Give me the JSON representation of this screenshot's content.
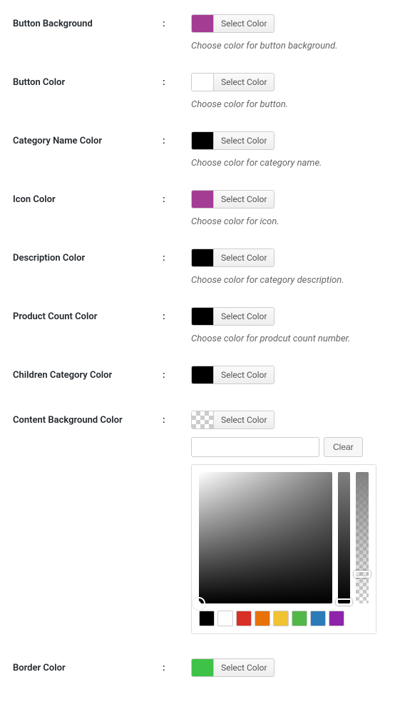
{
  "selectColorLabel": "Select Color",
  "clearLabel": "Clear",
  "fields": {
    "buttonBackground": {
      "label": "Button Background",
      "color": "#a43c93",
      "desc": "Choose color for button background."
    },
    "buttonColor": {
      "label": "Button Color",
      "color": "#ffffff",
      "desc": "Choose color for button."
    },
    "categoryNameColor": {
      "label": "Category Name Color",
      "color": "#000000",
      "desc": "Choose color for category name."
    },
    "iconColor": {
      "label": "Icon Color",
      "color": "#a43c93",
      "desc": "Choose color for icon."
    },
    "descriptionColor": {
      "label": "Description Color",
      "color": "#000000",
      "desc": "Choose color for category description."
    },
    "productCountColor": {
      "label": "Product Count Color",
      "color": "#000000",
      "desc": "Choose color for prodcut count number."
    },
    "childrenCategoryColor": {
      "label": "Children Category Color",
      "color": "#000000"
    },
    "contentBackgroundColor": {
      "label": "Content Background Color",
      "transparent": true,
      "hexValue": "",
      "palette": [
        "#000000",
        "#ffffff",
        "#d93025",
        "#e8710a",
        "#f1c232",
        "#51b749",
        "#2b7bb9",
        "#8e24aa"
      ]
    },
    "borderColor": {
      "label": "Border Color",
      "color": "#3fc248"
    }
  }
}
